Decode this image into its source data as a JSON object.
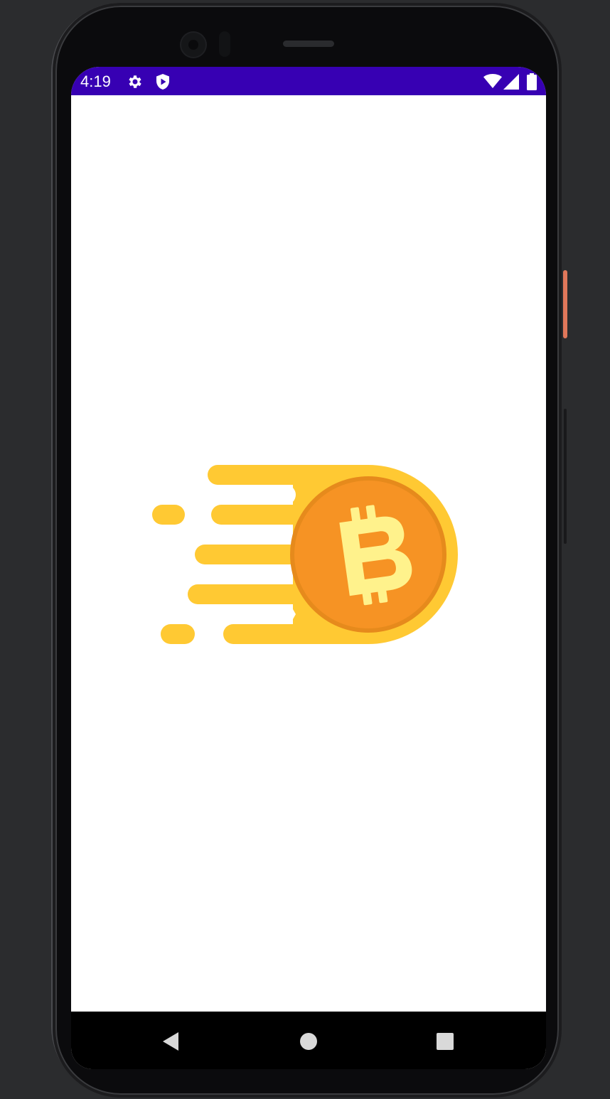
{
  "status_bar": {
    "time": "4:19",
    "background_color": "#3700b3",
    "left_icons": [
      "gear-icon",
      "shield-play-icon"
    ],
    "right_icons": [
      "wifi-icon",
      "signal-icon",
      "battery-icon"
    ]
  },
  "app": {
    "splash_logo": "bitcoin-coin-icon",
    "colors": {
      "trail": "#ffc933",
      "coin_outer": "#ffc933",
      "coin_face": "#f69324",
      "coin_ring": "#e68a1c",
      "symbol": "#fff28c"
    }
  },
  "nav_bar": {
    "buttons": [
      "back-icon",
      "home-icon",
      "recents-icon"
    ]
  }
}
